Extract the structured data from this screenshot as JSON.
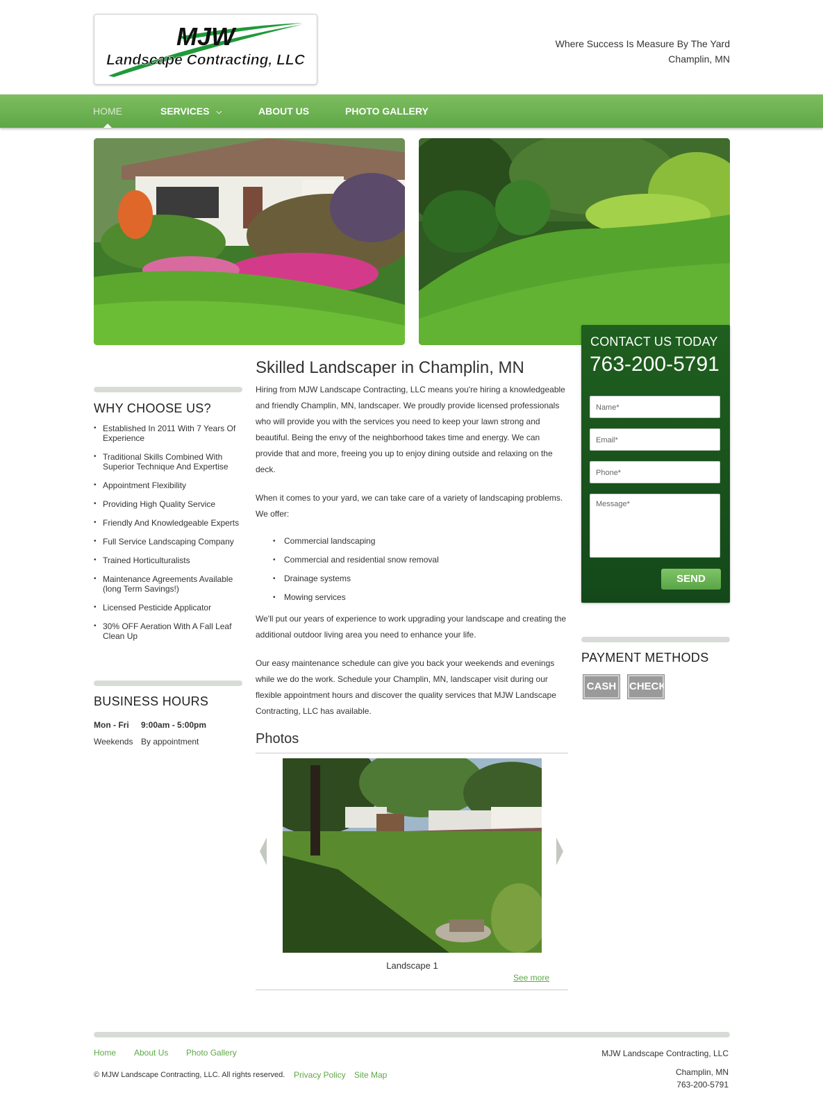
{
  "brand": {
    "logo_top": "MJW",
    "logo_bottom": "Landscape Contracting, LLC",
    "colors": {
      "green": "#5ea747",
      "dark_green": "#1f5f1f",
      "logo_green": "#1f9a3a"
    }
  },
  "header": {
    "tagline": "Where Success Is Measure By The Yard",
    "location": "Champlin, MN"
  },
  "nav": {
    "items": [
      {
        "label": "HOME",
        "active": true
      },
      {
        "label": "SERVICES",
        "has_dropdown": true,
        "icon": "chevron-down-icon"
      },
      {
        "label": "ABOUT US"
      },
      {
        "label": "PHOTO GALLERY"
      }
    ]
  },
  "contact": {
    "heading": "CONTACT US TODAY",
    "phone": "763-200-5791",
    "placeholders": {
      "name": "Name*",
      "email": "Email*",
      "phone": "Phone*",
      "message": "Message*"
    },
    "send_label": "SEND"
  },
  "why": {
    "heading": "WHY CHOOSE US?",
    "items": [
      "Established In 2011 With 7 Years Of Experience",
      "Traditional Skills Combined With Superior Technique And Expertise",
      "Appointment Flexibility",
      "Providing High Quality Service",
      "Friendly And Knowledgeable Experts",
      "Full Service Landscaping Company",
      "Trained Horticulturalists",
      "Maintenance Agreements Available (long Term Savings!)",
      "Licensed Pesticide Applicator",
      "30% OFF Aeration With A Fall Leaf Clean Up"
    ]
  },
  "hours": {
    "heading": "BUSINESS HOURS",
    "rows": [
      {
        "day": "Mon - Fri",
        "time": "9:00am - 5:00pm"
      },
      {
        "day": "Weekends",
        "time": "By appointment"
      }
    ]
  },
  "main": {
    "title": "Skilled Landscaper in Champlin, MN",
    "p1": "Hiring from MJW Landscape Contracting, LLC means you're hiring a knowledgeable and friendly Champlin, MN, landscaper. We proudly provide licensed professionals who will provide you with the services you need to keep your lawn strong and beautiful. Being the envy of the neighborhood takes time and energy. We can provide that and more, freeing you up to enjoy dining outside and relaxing on the deck.",
    "p2": "When it comes to your yard, we can take care of a variety of landscaping problems. We offer:",
    "offers": [
      "Commercial landscaping",
      "Commercial and residential snow removal",
      "Drainage systems",
      "Mowing services"
    ],
    "p3": "We'll put our years of experience to work upgrading your landscape and creating the additional outdoor living area you need to enhance your life.",
    "p4": "Our easy maintenance schedule can give you back your weekends and evenings while we do the work. Schedule your Champlin, MN, landscaper visit during our flexible appointment hours and discover the quality services that MJW Landscape Contracting, LLC has available."
  },
  "photos": {
    "heading": "Photos",
    "caption": "Landscape 1",
    "see_more": "See more"
  },
  "payment": {
    "heading": "PAYMENT METHODS",
    "methods": [
      "CASH",
      "CHECK"
    ]
  },
  "footer": {
    "links": [
      "Home",
      "About Us",
      "Photo Gallery"
    ],
    "copyright": "© MJW Landscape Contracting, LLC. All rights reserved.",
    "legal_links": [
      "Privacy Policy",
      "Site Map"
    ],
    "company": "MJW Landscape Contracting, LLC",
    "city": "Champlin, MN",
    "phone": "763-200-5791"
  }
}
